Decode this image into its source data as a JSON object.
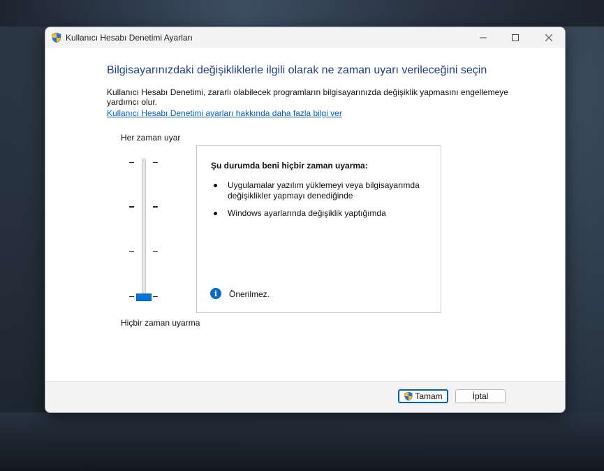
{
  "window": {
    "title": "Kullanıcı Hesabı Denetimi Ayarları",
    "controls": {
      "minimize": "—",
      "maximize": "☐",
      "close": "✕"
    }
  },
  "main": {
    "heading": "Bilgisayarınızdaki değişikliklerle ilgili olarak ne zaman uyarı verileceğini seçin",
    "description": "Kullanıcı Hesabı Denetimi, zararlı olabilecek programların bilgisayarınızda değişiklik yapmasını engellemeye yardımcı olur.",
    "learn_more_link": "Kullanıcı Hesabı Denetimi ayarları hakkında daha fazla bilgi ver"
  },
  "slider": {
    "top_label": "Her zaman uyar",
    "bottom_label": "Hiçbir zaman uyarma",
    "levels": 4,
    "selected_level": 1
  },
  "info_panel": {
    "title": "Şu durumda beni hiçbir zaman uyarma:",
    "bullets": [
      "Uygulamalar yazılım yüklemeyi veya bilgisayarımda değişiklikler yapmayı denediğinde",
      "Windows ayarlarında değişiklik yaptığımda"
    ],
    "note": "Önerilmez.",
    "note_icon": "info-icon"
  },
  "footer": {
    "ok_label": "Tamam",
    "cancel_label": "İptal"
  },
  "colors": {
    "accent": "#005fb8",
    "heading": "#1e3f8a",
    "link": "#0a5fb8"
  }
}
